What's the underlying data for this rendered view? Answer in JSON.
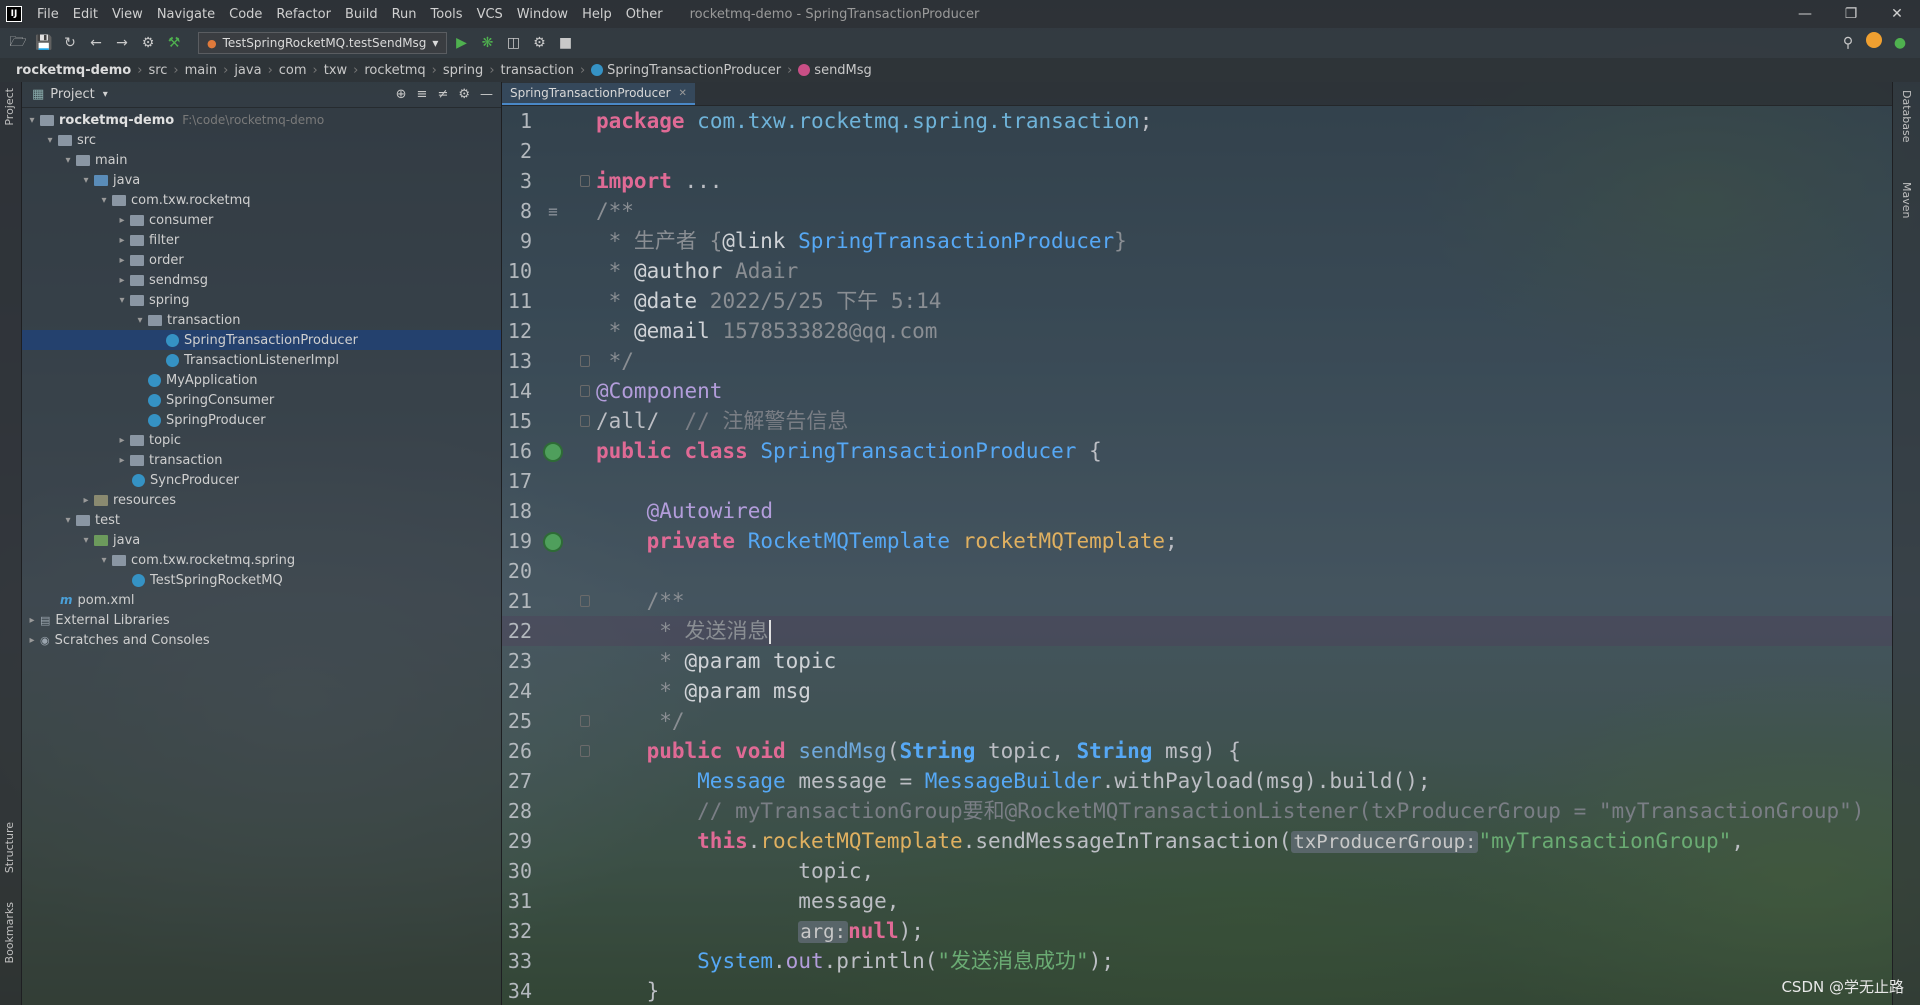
{
  "menubar": {
    "logo": "IJ",
    "items": [
      "File",
      "Edit",
      "View",
      "Navigate",
      "Code",
      "Refactor",
      "Build",
      "Run",
      "Tools",
      "VCS",
      "Window",
      "Help",
      "Other"
    ],
    "title": "rocketmq-demo - SpringTransactionProducer"
  },
  "toolbar": {
    "run_config": "TestSpringRocketMQ.testSendMsg"
  },
  "breadcrumb": {
    "items": [
      "rocketmq-demo",
      "src",
      "main",
      "java",
      "com",
      "txw",
      "rocketmq",
      "spring",
      "transaction",
      "SpringTransactionProducer",
      "sendMsg"
    ]
  },
  "left_strip": {
    "project": "Project",
    "structure": "Structure",
    "bookmarks": "Bookmarks"
  },
  "right_strip": {
    "database": "Database",
    "maven": "Maven"
  },
  "project": {
    "header": "Project",
    "tree": [
      {
        "label": "rocketmq-demo",
        "extra": "F:\\code\\rocketmq-demo"
      },
      {
        "label": "src"
      },
      {
        "label": "main"
      },
      {
        "label": "java"
      },
      {
        "label": "com.txw.rocketmq"
      },
      {
        "label": "consumer"
      },
      {
        "label": "filter"
      },
      {
        "label": "order"
      },
      {
        "label": "sendmsg"
      },
      {
        "label": "spring"
      },
      {
        "label": "transaction"
      },
      {
        "label": "SpringTransactionProducer"
      },
      {
        "label": "TransactionListenerImpl"
      },
      {
        "label": "MyApplication"
      },
      {
        "label": "SpringConsumer"
      },
      {
        "label": "SpringProducer"
      },
      {
        "label": "topic"
      },
      {
        "label": "transaction"
      },
      {
        "label": "SyncProducer"
      },
      {
        "label": "resources"
      },
      {
        "label": "test"
      },
      {
        "label": "java"
      },
      {
        "label": "com.txw.rocketmq.spring"
      },
      {
        "label": "TestSpringRocketMQ"
      },
      {
        "label": "pom.xml"
      },
      {
        "label": "External Libraries"
      },
      {
        "label": "Scratches and Consoles"
      }
    ]
  },
  "editor": {
    "tab": "SpringTransactionProducer",
    "line_numbers": [
      "1",
      "2",
      "3",
      "8",
      "9",
      "10",
      "11",
      "12",
      "13",
      "14",
      "15",
      "16",
      "17",
      "18",
      "19",
      "20",
      "21",
      "22",
      "23",
      "24",
      "25",
      "26",
      "27",
      "28",
      "29",
      "30",
      "31",
      "32",
      "33",
      "34"
    ],
    "code": {
      "l1_kw": "package",
      "l1_pkg": "com.txw.rocketmq.spring.transaction",
      "l1_end": ";",
      "l3_kw": "import",
      "l3_rest": " ...",
      "l8": "/**",
      "l9_a": " * 生产者 {",
      "l9_b": "@link",
      "l9_c": "SpringTransactionProducer",
      "l9_d": "}",
      "l10_a": " * ",
      "l10_b": "@author",
      "l10_c": " Adair",
      "l11_b": "@date",
      "l11_c": " 2022/5/25 下午 5:14",
      "l12_b": "@email",
      "l12_c": " 1578533828@qq.com",
      "l13": " */",
      "l14": "@Component",
      "l15_a": "/all/",
      "l15_b": "  // 注解警告信息",
      "l16_a": "public class",
      "l16_b": "SpringTransactionProducer",
      "l16_c": " {",
      "l18": "@Autowired",
      "l19_a": "private",
      "l19_b": "RocketMQTemplate",
      "l19_c": "rocketMQTemplate",
      "l19_d": ";",
      "l21": "/**",
      "l22": " * 发送消息",
      "l23_a": " * ",
      "l23_b": "@param",
      "l23_c": " topic",
      "l24_c": " msg",
      "l25": " */",
      "l26_a": "public void",
      "l26_b": "sendMsg",
      "l26_c": "(",
      "l26_d": "String",
      "l26_e": " topic, ",
      "l26_f": " msg) {",
      "l27_a": "Message",
      "l27_b": " message = ",
      "l27_c": "MessageBuilder",
      "l27_d": ".withPayload(msg).build();",
      "l28": "// myTransactionGroup要和@RocketMQTransactionListener(txProducerGroup = \"myTransactionGroup\")",
      "l29_a": "this",
      "l29_b": ".",
      "l29_c": "rocketMQTemplate",
      "l29_d": ".sendMessageInTransaction(",
      "l29_hint": "txProducerGroup:",
      "l29_str": "\"myTransactionGroup\"",
      "l29_e": ",",
      "l30": "topic,",
      "l31": "message,",
      "l32_hint": "arg:",
      "l32_kw": "null",
      "l32_e": ");",
      "l33_a": "System",
      "l33_b": ".",
      "l33_c": "out",
      "l33_d": ".println(",
      "l33_str": "\"发送消息成功\"",
      "l33_e": ");",
      "l34": "}"
    }
  },
  "watermark": "CSDN @学无止路"
}
